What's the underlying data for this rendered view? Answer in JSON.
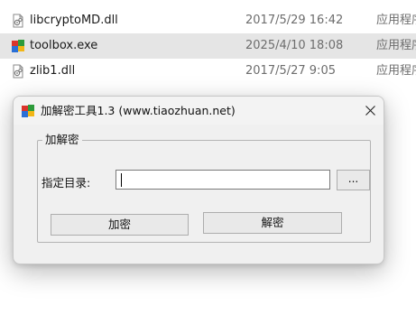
{
  "explorer": {
    "files": [
      {
        "name": "libcryptoMD.dll",
        "date": "2017/5/29 16:42",
        "type": "应用程序扩",
        "icon": "dll-file-icon",
        "selected": false
      },
      {
        "name": "toolbox.exe",
        "date": "2025/4/10 18:08",
        "type": "应用程序",
        "icon": "exe-app-icon",
        "selected": true
      },
      {
        "name": "zlib1.dll",
        "date": "2017/5/27 9:05",
        "type": "应用程序扩",
        "icon": "dll-file-icon",
        "selected": false
      }
    ]
  },
  "dialog": {
    "title": "加解密工具1.3 (www.tiaozhuan.net)",
    "close_icon": "close-icon",
    "group_title": "加解密",
    "dir_label": "指定目录:",
    "dir_value": "",
    "browse_label": "...",
    "encrypt_label": "加密",
    "decrypt_label": "解密"
  },
  "colors": {
    "selected_row": "#e5e5e5",
    "dialog_bg": "#f0f0f0",
    "button_bg": "#e9e9e9",
    "secondary_text": "#6d6d6d"
  }
}
